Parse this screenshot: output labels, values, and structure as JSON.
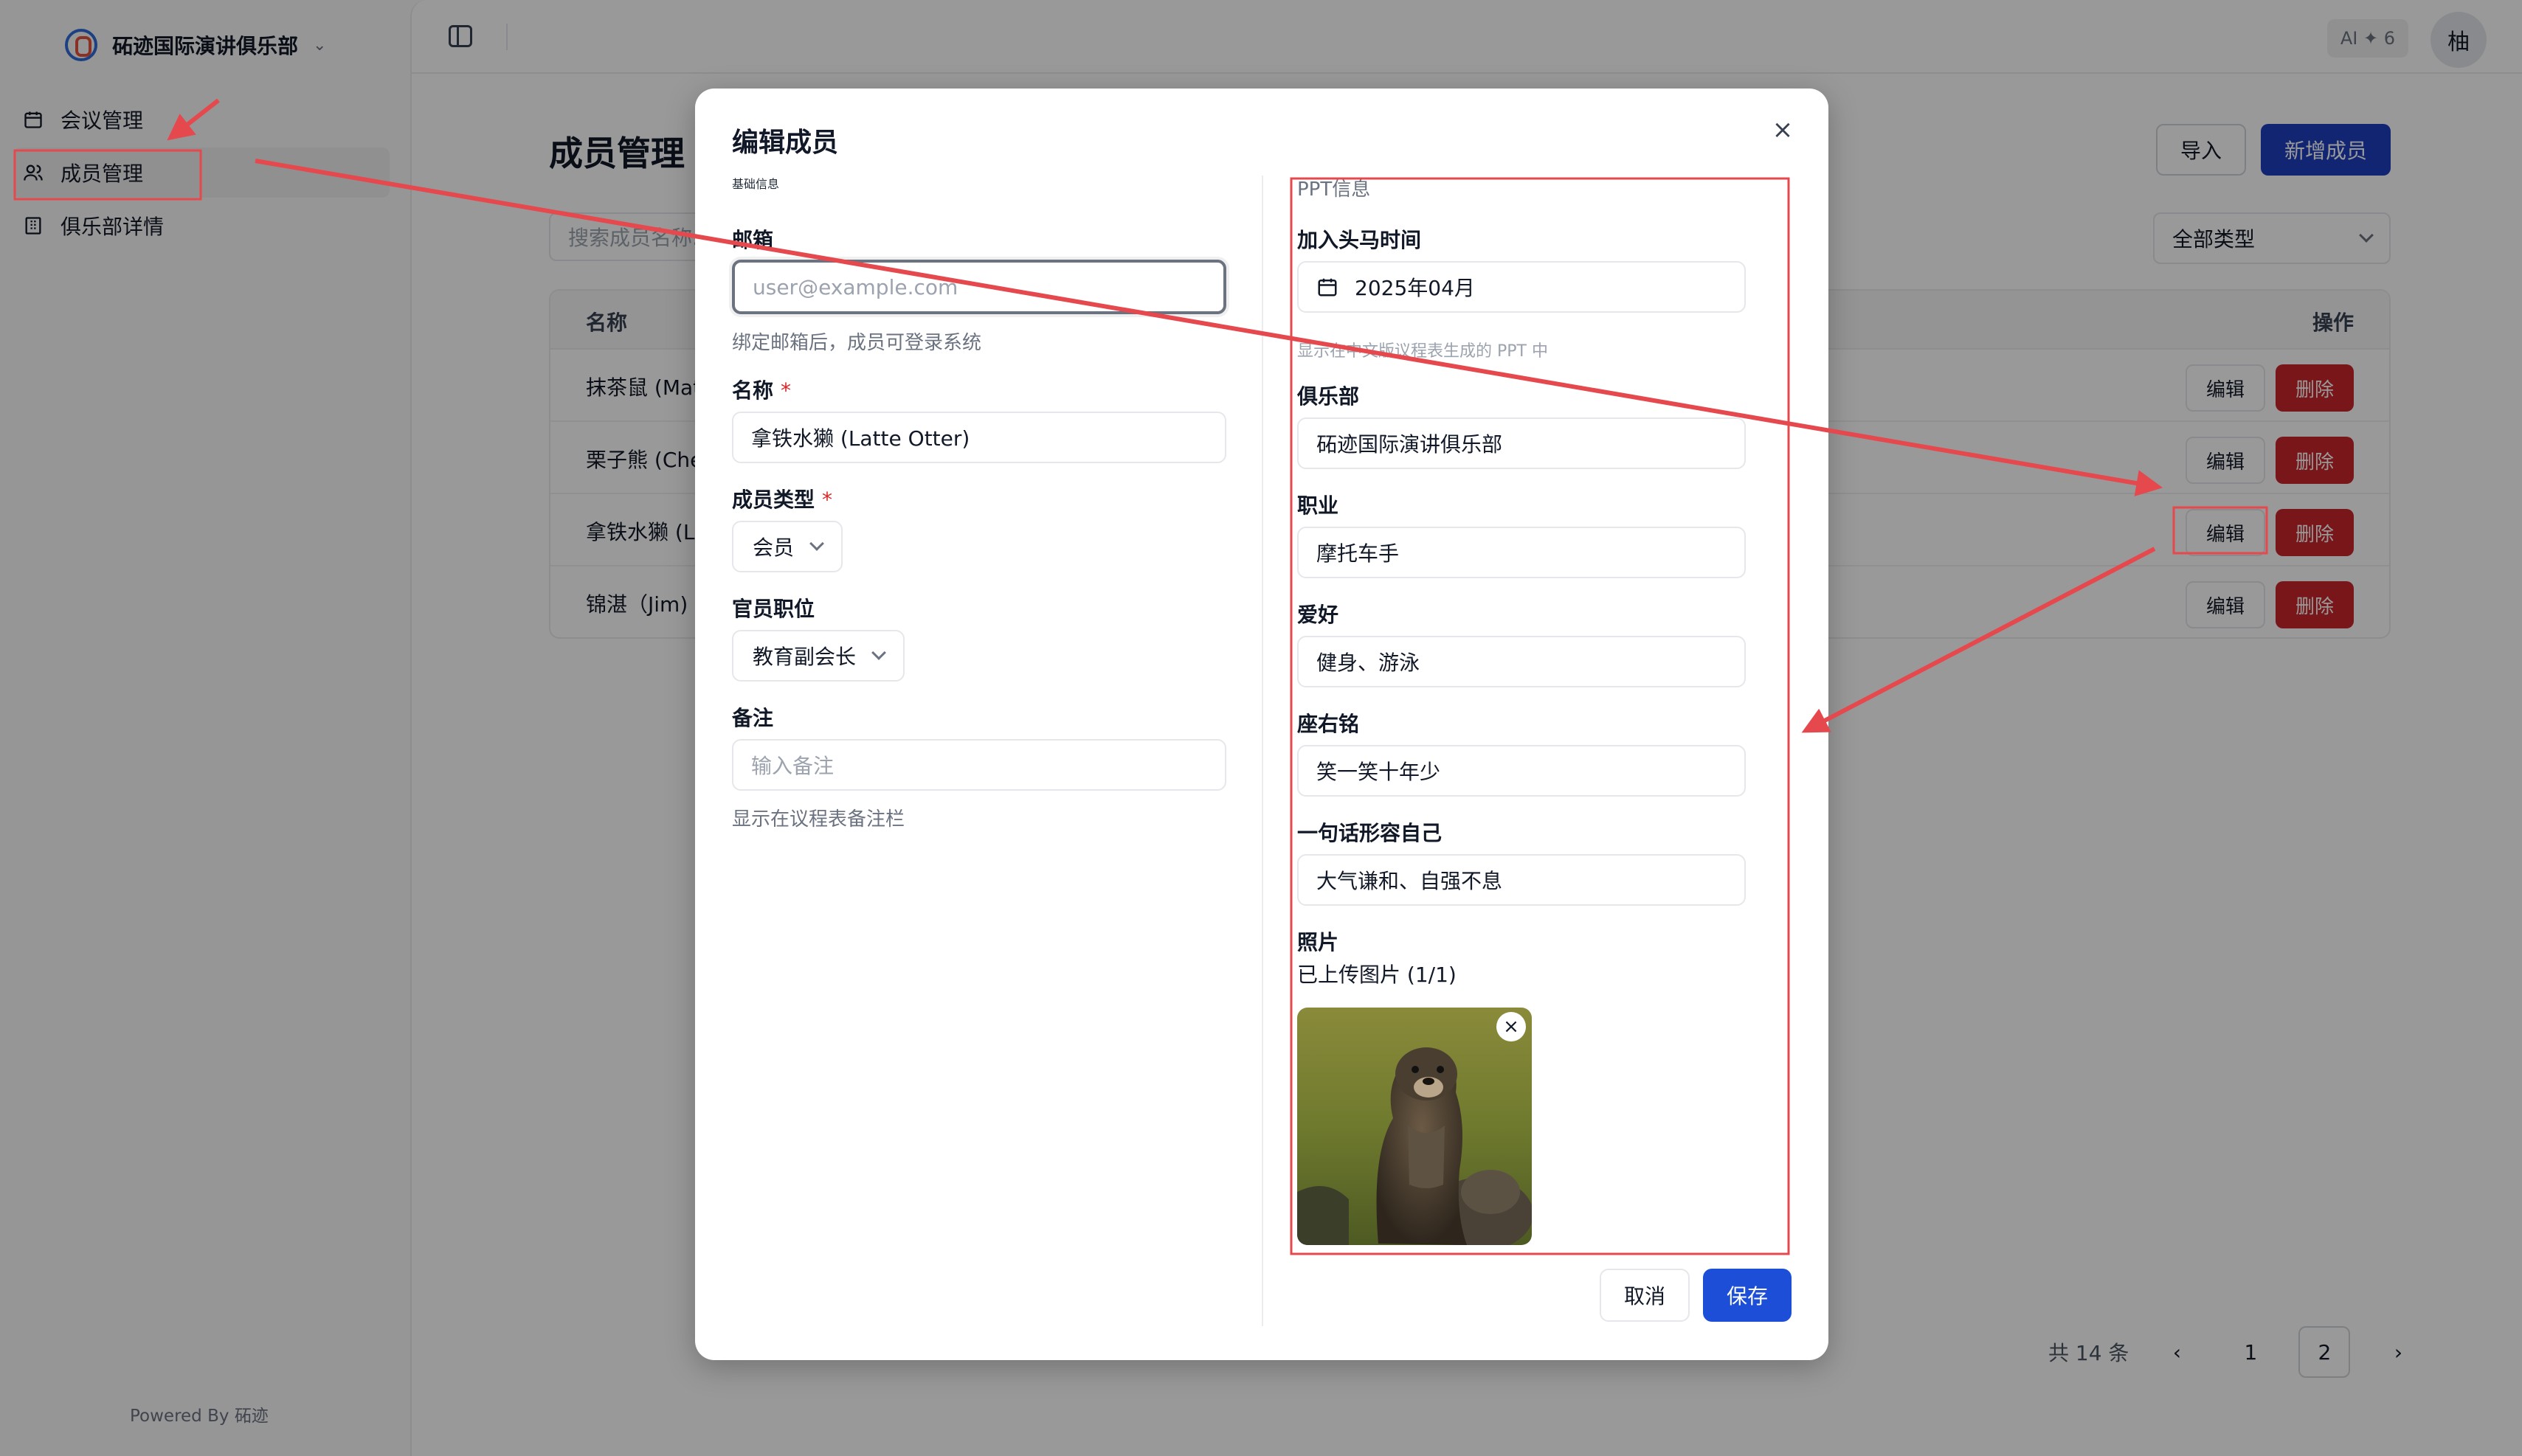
{
  "sidebar": {
    "club_name": "砳迹国际演讲俱乐部",
    "items": [
      {
        "label": "会议管理",
        "icon": "calendar-icon"
      },
      {
        "label": "成员管理",
        "icon": "users-icon"
      },
      {
        "label": "俱乐部详情",
        "icon": "building-icon"
      }
    ],
    "powered_by": "Powered By 砳迹"
  },
  "topbar": {
    "ai_badge": "AI ✦ 6",
    "avatar_text": "柚"
  },
  "page": {
    "title": "成员管理",
    "import_label": "导入",
    "new_label": "新增成员",
    "search_placeholder": "搜索成员名称...",
    "type_filter": "全部类型"
  },
  "table": {
    "headers": {
      "name": "名称",
      "ops": "操作"
    },
    "rows": [
      {
        "name": "抹茶鼠 (Mat"
      },
      {
        "name": "栗子熊 (Che"
      },
      {
        "name": "拿铁水獭 (La"
      },
      {
        "name": "锦湛（Jim)"
      }
    ],
    "edit_label": "编辑",
    "delete_label": "删除"
  },
  "pagination": {
    "total": "共 14 条",
    "prev": "‹",
    "pages": [
      "1",
      "2"
    ],
    "current": "2",
    "next": "›"
  },
  "modal": {
    "title": "编辑成员",
    "close": "×",
    "basic": {
      "section": "基础信息",
      "email_label": "邮箱",
      "email_placeholder": "user@example.com",
      "email_helper": "绑定邮箱后，成员可登录系统",
      "name_label": "名称",
      "name_value": "拿铁水獭 (Latte Otter)",
      "type_label": "成员类型",
      "type_value": "会员",
      "officer_label": "官员职位",
      "officer_value": "教育副会长",
      "note_label": "备注",
      "note_placeholder": "输入备注",
      "note_helper": "显示在议程表备注栏",
      "required_mark": "*"
    },
    "ppt": {
      "section": "PPT信息",
      "join_label": "加入头马时间",
      "join_value": "2025年04月",
      "join_helper": "显示在中文版议程表生成的 PPT 中",
      "club_label": "俱乐部",
      "club_value": "砳迹国际演讲俱乐部",
      "job_label": "职业",
      "job_value": "摩托车手",
      "hobby_label": "爱好",
      "hobby_value": "健身、游泳",
      "motto_label": "座右铭",
      "motto_value": "笑一笑十年少",
      "self_label": "一句话形容自己",
      "self_value": "大气谦和、自强不息",
      "photo_label": "照片",
      "photo_status": "已上传图片 (1/1)",
      "photo_remove": "×"
    },
    "cancel_label": "取消",
    "save_label": "保存"
  },
  "colors": {
    "primary": "#1d4ed8",
    "danger": "#c8252b",
    "annotation": "#e5484d"
  }
}
